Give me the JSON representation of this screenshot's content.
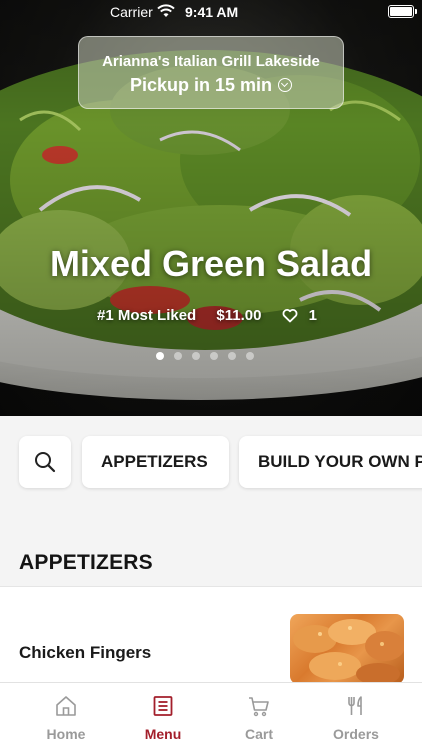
{
  "status_bar": {
    "carrier": "Carrier",
    "time": "9:41 AM",
    "icons": [
      "wifi-icon",
      "battery-icon"
    ]
  },
  "location": {
    "name": "Arianna's Italian Grill Lakeside",
    "pickup": "Pickup in 15 min",
    "icon": "chevron-down-circle-icon"
  },
  "featured": {
    "title": "Mixed Green Salad",
    "rank": "#1 Most Liked",
    "price": "$11.00",
    "likes": "1",
    "slide_count": 6,
    "active_slide": 1
  },
  "categories": {
    "search_icon": "search-icon",
    "items": [
      "APPETIZERS",
      "BUILD YOUR OWN PIZZA"
    ]
  },
  "section": {
    "title": "APPETIZERS",
    "items": [
      {
        "name": "Chicken Fingers"
      }
    ]
  },
  "tab_bar": {
    "tabs": [
      {
        "label": "Home",
        "icon": "home-icon",
        "active": false
      },
      {
        "label": "Menu",
        "icon": "menu-icon",
        "active": true
      },
      {
        "label": "Cart",
        "icon": "cart-icon",
        "active": false
      },
      {
        "label": "Orders",
        "icon": "fork-knife-icon",
        "active": false
      }
    ]
  },
  "colors": {
    "accent": "#a31f2b",
    "background": "#f4f4f4",
    "inactive_tab": "#9a9a9a"
  }
}
